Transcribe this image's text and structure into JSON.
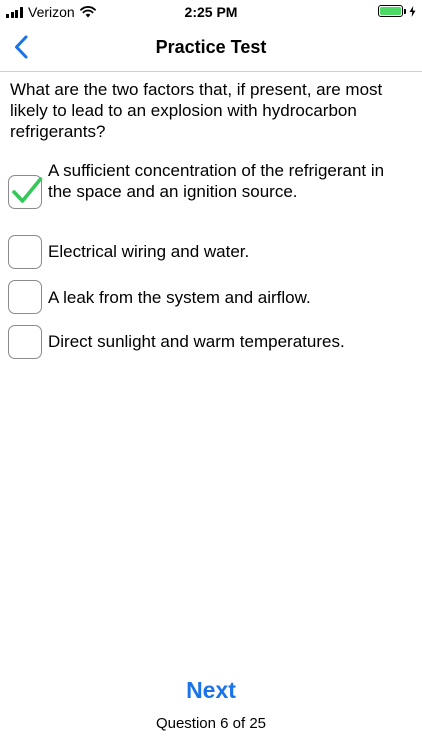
{
  "status_bar": {
    "carrier": "Verizon",
    "time": "2:25 PM",
    "battery_color": "#4cd964"
  },
  "nav": {
    "back_icon": "chevron-left-icon",
    "title": "Practice Test",
    "accent_color": "#1a73e8"
  },
  "question": {
    "text": "What are the two factors that, if present, are most likely to lead to an explosion with hydrocarbon refrigerants?"
  },
  "options": [
    {
      "label": "A sufficient concentration of the refrigerant in the space and an ignition source.",
      "checked": true
    },
    {
      "label": "Electrical wiring and water.",
      "checked": false
    },
    {
      "label": "A leak from the system and airflow.",
      "checked": false
    },
    {
      "label": "Direct sunlight and warm temperatures.",
      "checked": false
    }
  ],
  "footer": {
    "next_label": "Next",
    "progress_text": "Question 6 of 25",
    "current_question": 6,
    "total_questions": 25
  },
  "colors": {
    "check_green": "#34c759",
    "accent_blue": "#1a73e8"
  }
}
